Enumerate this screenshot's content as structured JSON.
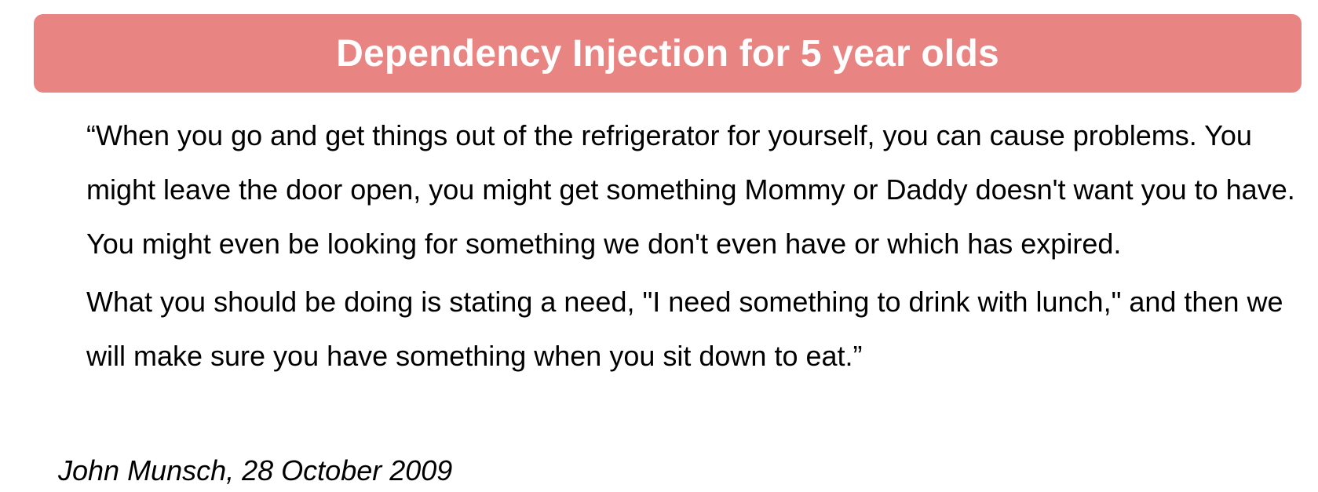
{
  "slide": {
    "title": "Dependency Injection for 5 year olds",
    "banner_color": "#e88482",
    "quote": {
      "paragraphs": [
        "“When you go and get things out of the refrigerator for yourself, you can cause problems. You might leave the door open, you might get something Mommy or Daddy doesn't want you to have. You might even be looking for something we don't even have or which has expired.",
        "What you should be doing is stating a need, \"I need something to drink with lunch,\" and then we will make sure you have something when you sit down to eat.”"
      ]
    },
    "attribution": "John Munsch, 28 October 2009"
  }
}
